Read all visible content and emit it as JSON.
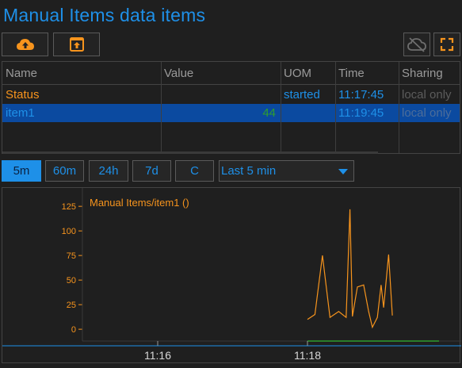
{
  "header": {
    "title": "Manual Items data items"
  },
  "toolbar": {
    "upload_icon": "cloud-upload-icon",
    "export_icon": "export-icon",
    "offline_icon": "cloud-off-icon",
    "fullscreen_icon": "fullscreen-icon",
    "accent": "#f7941d"
  },
  "table": {
    "columns": [
      "Name",
      "Value",
      "UOM",
      "Time",
      "Sharing"
    ],
    "rows": [
      {
        "name": "Status",
        "value": "",
        "uom": "started",
        "time": "11:17:45",
        "sharing": "local only"
      },
      {
        "name": "item1",
        "value": "44",
        "uom": "",
        "time": "11:19:45",
        "sharing": "local only"
      }
    ]
  },
  "ranges": {
    "buttons": [
      "5m",
      "60m",
      "24h",
      "7d",
      "C"
    ],
    "active": "5m",
    "selected": "Last 5 min"
  },
  "chart_data": {
    "type": "line",
    "series": [
      {
        "name": "Manual Items/item1 ()",
        "color": "#f7941d",
        "points": [
          [
            0,
            10
          ],
          [
            6,
            15
          ],
          [
            12,
            75
          ],
          [
            18,
            12
          ],
          [
            25,
            18
          ],
          [
            31,
            12
          ],
          [
            34,
            122
          ],
          [
            36,
            13
          ],
          [
            40,
            43
          ],
          [
            45,
            45
          ],
          [
            49,
            18
          ],
          [
            52,
            2
          ],
          [
            56,
            12
          ],
          [
            59,
            45
          ],
          [
            61,
            22
          ],
          [
            65,
            76
          ],
          [
            68,
            14
          ]
        ]
      }
    ],
    "series_x_unit": "seconds after 11:18",
    "yticks": [
      125,
      100,
      75,
      50,
      25,
      0
    ],
    "ylim": [
      -12,
      134
    ],
    "xticks": [
      "11:16",
      "11:18"
    ],
    "baseline_color": "#2e9e2e"
  }
}
